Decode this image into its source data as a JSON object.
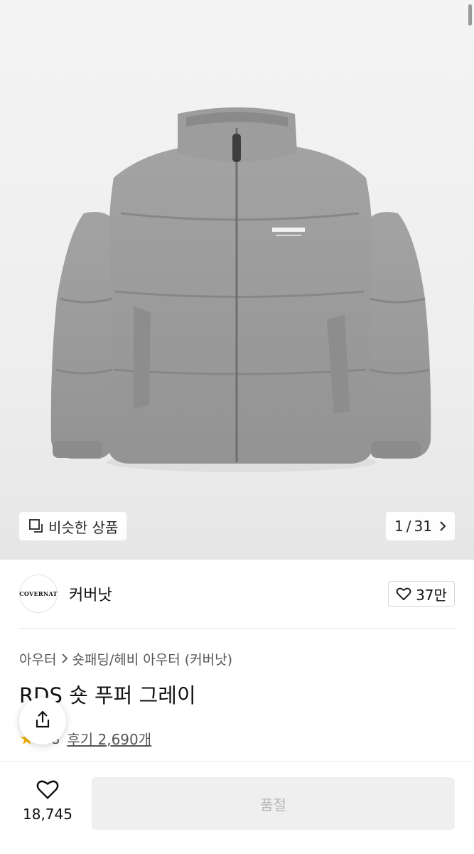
{
  "gallery": {
    "similar_label": "비슷한 상품",
    "current": "1",
    "separator": "/",
    "total": "31"
  },
  "brand": {
    "logo_text": "COVERNAT",
    "name": "커버낫",
    "likes": "37만"
  },
  "breadcrumb": {
    "category": "아우터",
    "subcategory": "숏패딩/헤비 아우터 (커버낫)"
  },
  "product": {
    "title": "RDS 숏 푸퍼 그레이",
    "rating": "4.8",
    "reviews": "후기 2,690개"
  },
  "bottom": {
    "wish_count": "18,745",
    "soldout_label": "품절"
  },
  "icons": {
    "similar": "overlapping-squares-icon",
    "next": "chevron-right-icon",
    "like": "heart-outline-icon",
    "share": "share-icon",
    "rating": "star-icon"
  },
  "colors": {
    "star": "#f4b400",
    "jacket": "#9a9a9a",
    "disabled_button": "#efefef"
  }
}
